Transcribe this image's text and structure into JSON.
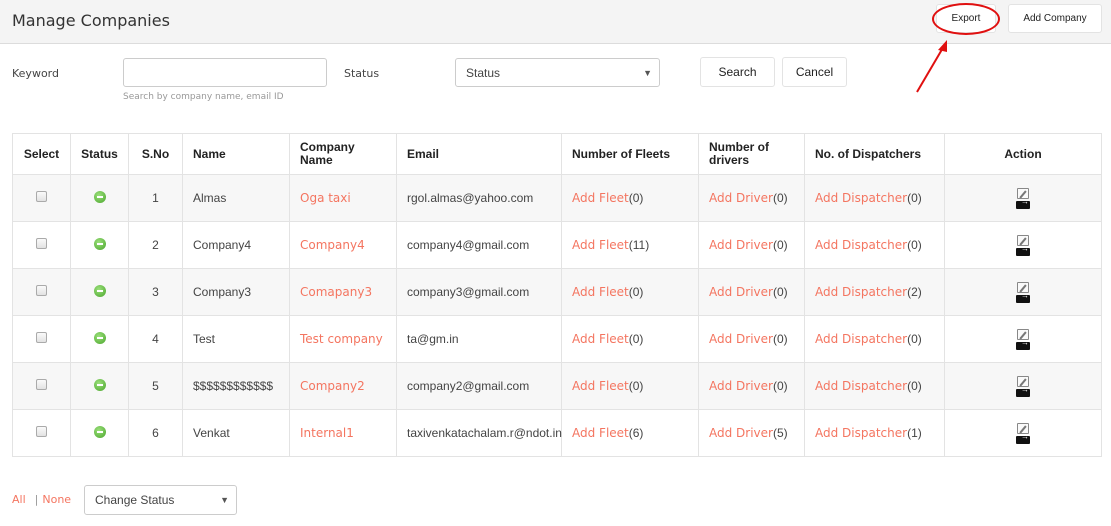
{
  "header": {
    "title": "Manage Companies",
    "export_label": "Export",
    "add_company_label": "Add Company"
  },
  "filters": {
    "keyword_label": "Keyword",
    "keyword_value": "",
    "keyword_placeholder": "",
    "keyword_help": "Search by company name, email ID",
    "status_label": "Status",
    "status_selected": "Status",
    "search_label": "Search",
    "cancel_label": "Cancel"
  },
  "table": {
    "columns": [
      "Select",
      "Status",
      "S.No",
      "Name",
      "Company Name",
      "Email",
      "Number of Fleets",
      "Number of drivers",
      "No. of Dispatchers",
      "Action"
    ],
    "rows": [
      {
        "sno": "1",
        "name": "Almas",
        "company": "Oga taxi",
        "email": "rgol.almas@yahoo.com",
        "fleet_link": "Add Fleet",
        "fleets": "(0)",
        "driver_link": "Add Driver",
        "drivers": "(0)",
        "dispatcher_link": "Add Dispatcher",
        "dispatchers": "(0)",
        "status": "active"
      },
      {
        "sno": "2",
        "name": "Company4",
        "company": "Company4",
        "email": "company4@gmail.com",
        "fleet_link": "Add Fleet",
        "fleets": "(11)",
        "driver_link": "Add Driver",
        "drivers": "(0)",
        "dispatcher_link": "Add Dispatcher",
        "dispatchers": "(0)",
        "status": "active"
      },
      {
        "sno": "3",
        "name": "Company3",
        "company": "Comapany3",
        "email": "company3@gmail.com",
        "fleet_link": "Add Fleet",
        "fleets": "(0)",
        "driver_link": "Add Driver",
        "drivers": "(0)",
        "dispatcher_link": "Add Dispatcher",
        "dispatchers": "(2)",
        "status": "active"
      },
      {
        "sno": "4",
        "name": "Test",
        "company": "Test company",
        "email": "ta@gm.in",
        "fleet_link": "Add Fleet",
        "fleets": "(0)",
        "driver_link": "Add Driver",
        "drivers": "(0)",
        "dispatcher_link": "Add Dispatcher",
        "dispatchers": "(0)",
        "status": "active"
      },
      {
        "sno": "5",
        "name": "$$$$$$$$$$$$",
        "company": "Company2",
        "email": "company2@gmail.com",
        "fleet_link": "Add Fleet",
        "fleets": "(0)",
        "driver_link": "Add Driver",
        "drivers": "(0)",
        "dispatcher_link": "Add Dispatcher",
        "dispatchers": "(0)",
        "status": "active"
      },
      {
        "sno": "6",
        "name": "Venkat",
        "company": "Internal1",
        "email": "taxivenkatachalam.r@ndot.in",
        "fleet_link": "Add Fleet",
        "fleets": "(6)",
        "driver_link": "Add Driver",
        "drivers": "(5)",
        "dispatcher_link": "Add Dispatcher",
        "dispatchers": "(1)",
        "status": "active"
      }
    ]
  },
  "footer": {
    "all_label": "All",
    "separator": "|",
    "none_label": "None",
    "change_status_selected": "Change Status"
  },
  "icons": {
    "status": "status-active-icon",
    "edit": "edit-icon",
    "login": "login-icon",
    "caret": "▼"
  },
  "colors": {
    "link": "#f47560",
    "annotation": "#e01010",
    "status_active": "#4aa52c"
  }
}
